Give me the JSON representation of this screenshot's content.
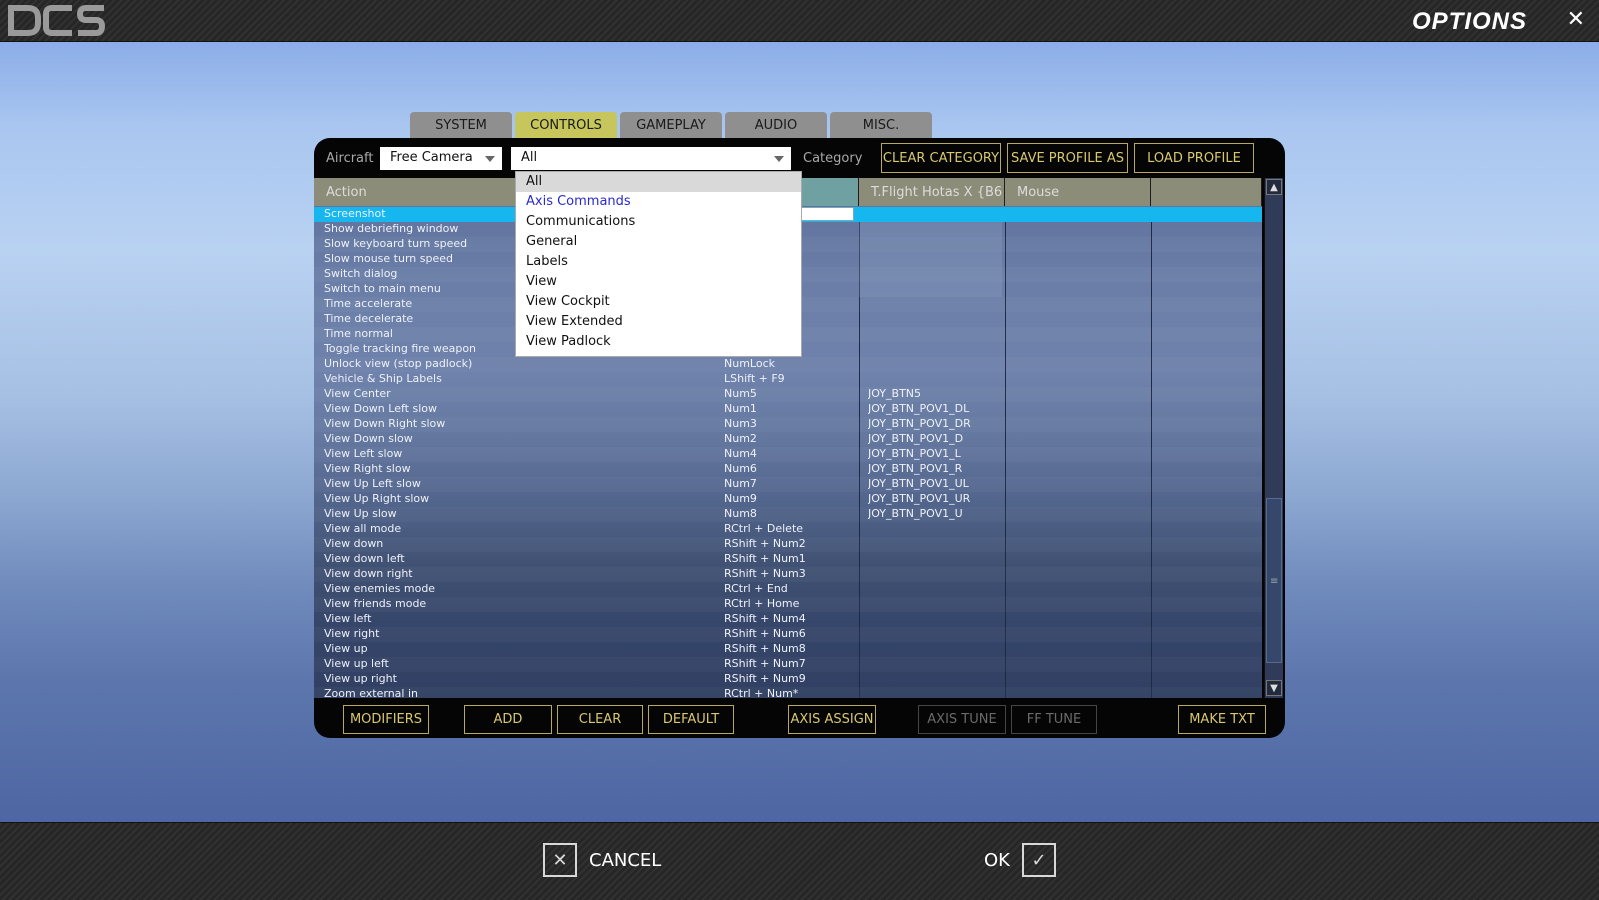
{
  "header": {
    "logo_text": "DCS",
    "title": "OPTIONS",
    "close_icon": "close-icon"
  },
  "tabs": [
    {
      "label": "SYSTEM",
      "active": false
    },
    {
      "label": "CONTROLS",
      "active": true
    },
    {
      "label": "GAMEPLAY",
      "active": false
    },
    {
      "label": "AUDIO",
      "active": false
    },
    {
      "label": "MISC.",
      "active": false
    }
  ],
  "toolbar": {
    "aircraft_label": "Aircraft",
    "aircraft_value": "Free Camera",
    "category_value": "All",
    "category_label": "Category",
    "clear_category": "CLEAR CATEGORY",
    "save_profile_as": "SAVE PROFILE AS",
    "load_profile": "LOAD PROFILE"
  },
  "category_options": [
    "All",
    "Axis Commands",
    "Communications",
    "General",
    "Labels",
    "View",
    "View Cockpit",
    "View Extended",
    "View Padlock"
  ],
  "grid": {
    "columns": [
      "Action",
      "",
      "T.Flight Hotas X {B6",
      "Mouse",
      ""
    ],
    "rows": [
      {
        "action": "Screenshot",
        "kbd": "",
        "joy": ""
      },
      {
        "action": "Show debriefing window",
        "kbd": "",
        "joy": ""
      },
      {
        "action": "Slow keyboard turn speed",
        "kbd": "",
        "joy": ""
      },
      {
        "action": "Slow mouse turn speed",
        "kbd": "",
        "joy": ""
      },
      {
        "action": "Switch dialog",
        "kbd": "",
        "joy": ""
      },
      {
        "action": "Switch to main menu",
        "kbd": "",
        "joy": ""
      },
      {
        "action": "Time accelerate",
        "kbd": "",
        "joy": ""
      },
      {
        "action": "Time decelerate",
        "kbd": "",
        "joy": ""
      },
      {
        "action": "Time normal",
        "kbd": "",
        "joy": ""
      },
      {
        "action": "Toggle tracking fire weapon",
        "kbd": "",
        "joy": ""
      },
      {
        "action": "Unlock view (stop padlock)",
        "kbd": "NumLock",
        "joy": ""
      },
      {
        "action": "Vehicle & Ship Labels",
        "kbd": "LShift + F9",
        "joy": ""
      },
      {
        "action": "View Center",
        "kbd": "Num5",
        "joy": "JOY_BTN5"
      },
      {
        "action": "View Down Left slow",
        "kbd": "Num1",
        "joy": "JOY_BTN_POV1_DL"
      },
      {
        "action": "View Down Right slow",
        "kbd": "Num3",
        "joy": "JOY_BTN_POV1_DR"
      },
      {
        "action": "View Down slow",
        "kbd": "Num2",
        "joy": "JOY_BTN_POV1_D"
      },
      {
        "action": "View Left slow",
        "kbd": "Num4",
        "joy": "JOY_BTN_POV1_L"
      },
      {
        "action": "View Right slow",
        "kbd": "Num6",
        "joy": "JOY_BTN_POV1_R"
      },
      {
        "action": "View Up Left slow",
        "kbd": "Num7",
        "joy": "JOY_BTN_POV1_UL"
      },
      {
        "action": "View Up Right slow",
        "kbd": "Num9",
        "joy": "JOY_BTN_POV1_UR"
      },
      {
        "action": "View Up slow",
        "kbd": "Num8",
        "joy": "JOY_BTN_POV1_U"
      },
      {
        "action": "View all mode",
        "kbd": "RCtrl + Delete",
        "joy": ""
      },
      {
        "action": "View down",
        "kbd": "RShift + Num2",
        "joy": ""
      },
      {
        "action": "View down left",
        "kbd": "RShift + Num1",
        "joy": ""
      },
      {
        "action": "View down right",
        "kbd": "RShift + Num3",
        "joy": ""
      },
      {
        "action": "View enemies mode",
        "kbd": "RCtrl + End",
        "joy": ""
      },
      {
        "action": "View friends mode",
        "kbd": "RCtrl + Home",
        "joy": ""
      },
      {
        "action": "View left",
        "kbd": "RShift + Num4",
        "joy": ""
      },
      {
        "action": "View right",
        "kbd": "RShift + Num6",
        "joy": ""
      },
      {
        "action": "View up",
        "kbd": "RShift + Num8",
        "joy": ""
      },
      {
        "action": "View up left",
        "kbd": "RShift + Num7",
        "joy": ""
      },
      {
        "action": "View up right",
        "kbd": "RShift + Num9",
        "joy": ""
      },
      {
        "action": "Zoom external in",
        "kbd": "RCtrl + Num*",
        "joy": ""
      }
    ]
  },
  "buttons": {
    "modifiers": "MODIFIERS",
    "add": "ADD",
    "clear": "CLEAR",
    "default": "DEFAULT",
    "axis_assign": "AXIS ASSIGN",
    "axis_tune": "AXIS TUNE",
    "ff_tune": "FF TUNE",
    "make_txt": "MAKE TXT"
  },
  "footer": {
    "cancel": "CANCEL",
    "ok": "OK"
  },
  "colors": {
    "accent_yellow": "#d8c86e",
    "selection_blue": "#16b6ee",
    "active_tab": "#c6c65d"
  }
}
